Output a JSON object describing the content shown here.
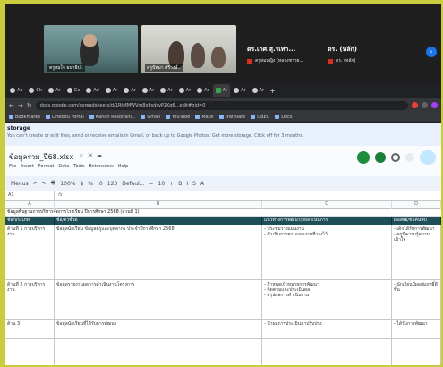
{
  "meet": {
    "participants": [
      {
        "label": "ครูสมใจ ธนาธิป.."
      },
      {
        "label": "ครูปัทมา ศรีวงษ์.."
      }
    ],
    "panel_names": [
      "ดร.เกศ.สุ.รเทา...",
      "ดร. (หลัก)"
    ],
    "sub_lines": [
      "ครูสมหญิง (หลวงชาวย...",
      "ดร. (หลัก)"
    ]
  },
  "browser": {
    "tabs": [
      "Ae",
      "Ch",
      "Ar",
      "Gc",
      "Ad",
      "Ar",
      "Ar",
      "Ar",
      "Ar",
      "Ar",
      "Ar",
      "Ar",
      "Ar",
      "Ar"
    ],
    "active_tab_index": 11,
    "url": "docs.google.com/spreadsheets/d/1RtMMWVm8x9sdsvP2Kq6...edit#gid=0",
    "bookmarks": [
      "Bookmarks",
      "LineEdu Portal",
      "Kanan Resonanc..",
      "Gmail",
      "YouTube",
      "Maps",
      "Translate",
      "OBEC",
      "Docs"
    ]
  },
  "banner": {
    "title": "storage",
    "text": "You can't create or edit files, send or receive emails in Gmail, or back up to Google Photos. Get more storage. Click off for 3 months."
  },
  "sheet": {
    "doc_title": "ข้อมูลรวม_ปี68.xlsx",
    "menus": [
      "File",
      "Insert",
      "Format",
      "Data",
      "Tools",
      "Extensions",
      "Help"
    ],
    "toolbar": [
      "Menus",
      "↶",
      "↷",
      "🖶",
      "100%",
      "$",
      "%",
      ".0",
      "123",
      "Defaul...",
      "−",
      "10",
      "+",
      "B",
      "I",
      "S",
      "A"
    ],
    "cell_ref": "A1",
    "formula": "fx",
    "columns": [
      "A",
      "B",
      "C",
      "D"
    ],
    "title_row": "ข้อมูลพื้นฐานการบริหารจัดการโรงเรียน ปีการศึกษา 2568 (ส่วนที่ 1)",
    "headers": [
      "ชื่อ/ประเภท",
      "ชื่อ/ตัวชี้วัด",
      "แนวทางการพัฒนา/วิธีดำเนินการ",
      "ผลลัพธ์/ข้อค้นพบ"
    ],
    "rows": [
      {
        "a": "ด้านที่ 1 การบริหารงาน",
        "b": "ข้อมูลนักเรียน ข้อมูลครูและบุคลากร ประจำปีการศึกษา 2568",
        "c": "- ประชุมวางแผนงาน\n- ดำเนินการตามแผนงานที่วางไว้",
        "d": "- เด็กได้รับการพัฒนา\n- ครูมีความรู้ความเข้าใจ"
      },
      {
        "a": "ด้านที่ 2 การบริหารงาน",
        "b": "ข้อมูลรายงานผลการดำเนินงานโครงการ",
        "c": "- กำหนดเป้าหมายการพัฒนา\n- ติดตามและประเมินผล\n- สรุปผลการดำเนินงาน",
        "d": "- นักเรียนมีผลสัมฤทธิ์ดีขึ้น"
      },
      {
        "a": "ด้าน 3 ",
        "b": "ข้อมูลนักเรียนที่ได้รับการพัฒนา",
        "c": "- นำผลการประเมินมาปรับปรุง",
        "d": "- ได้รับการพัฒนา"
      }
    ]
  }
}
